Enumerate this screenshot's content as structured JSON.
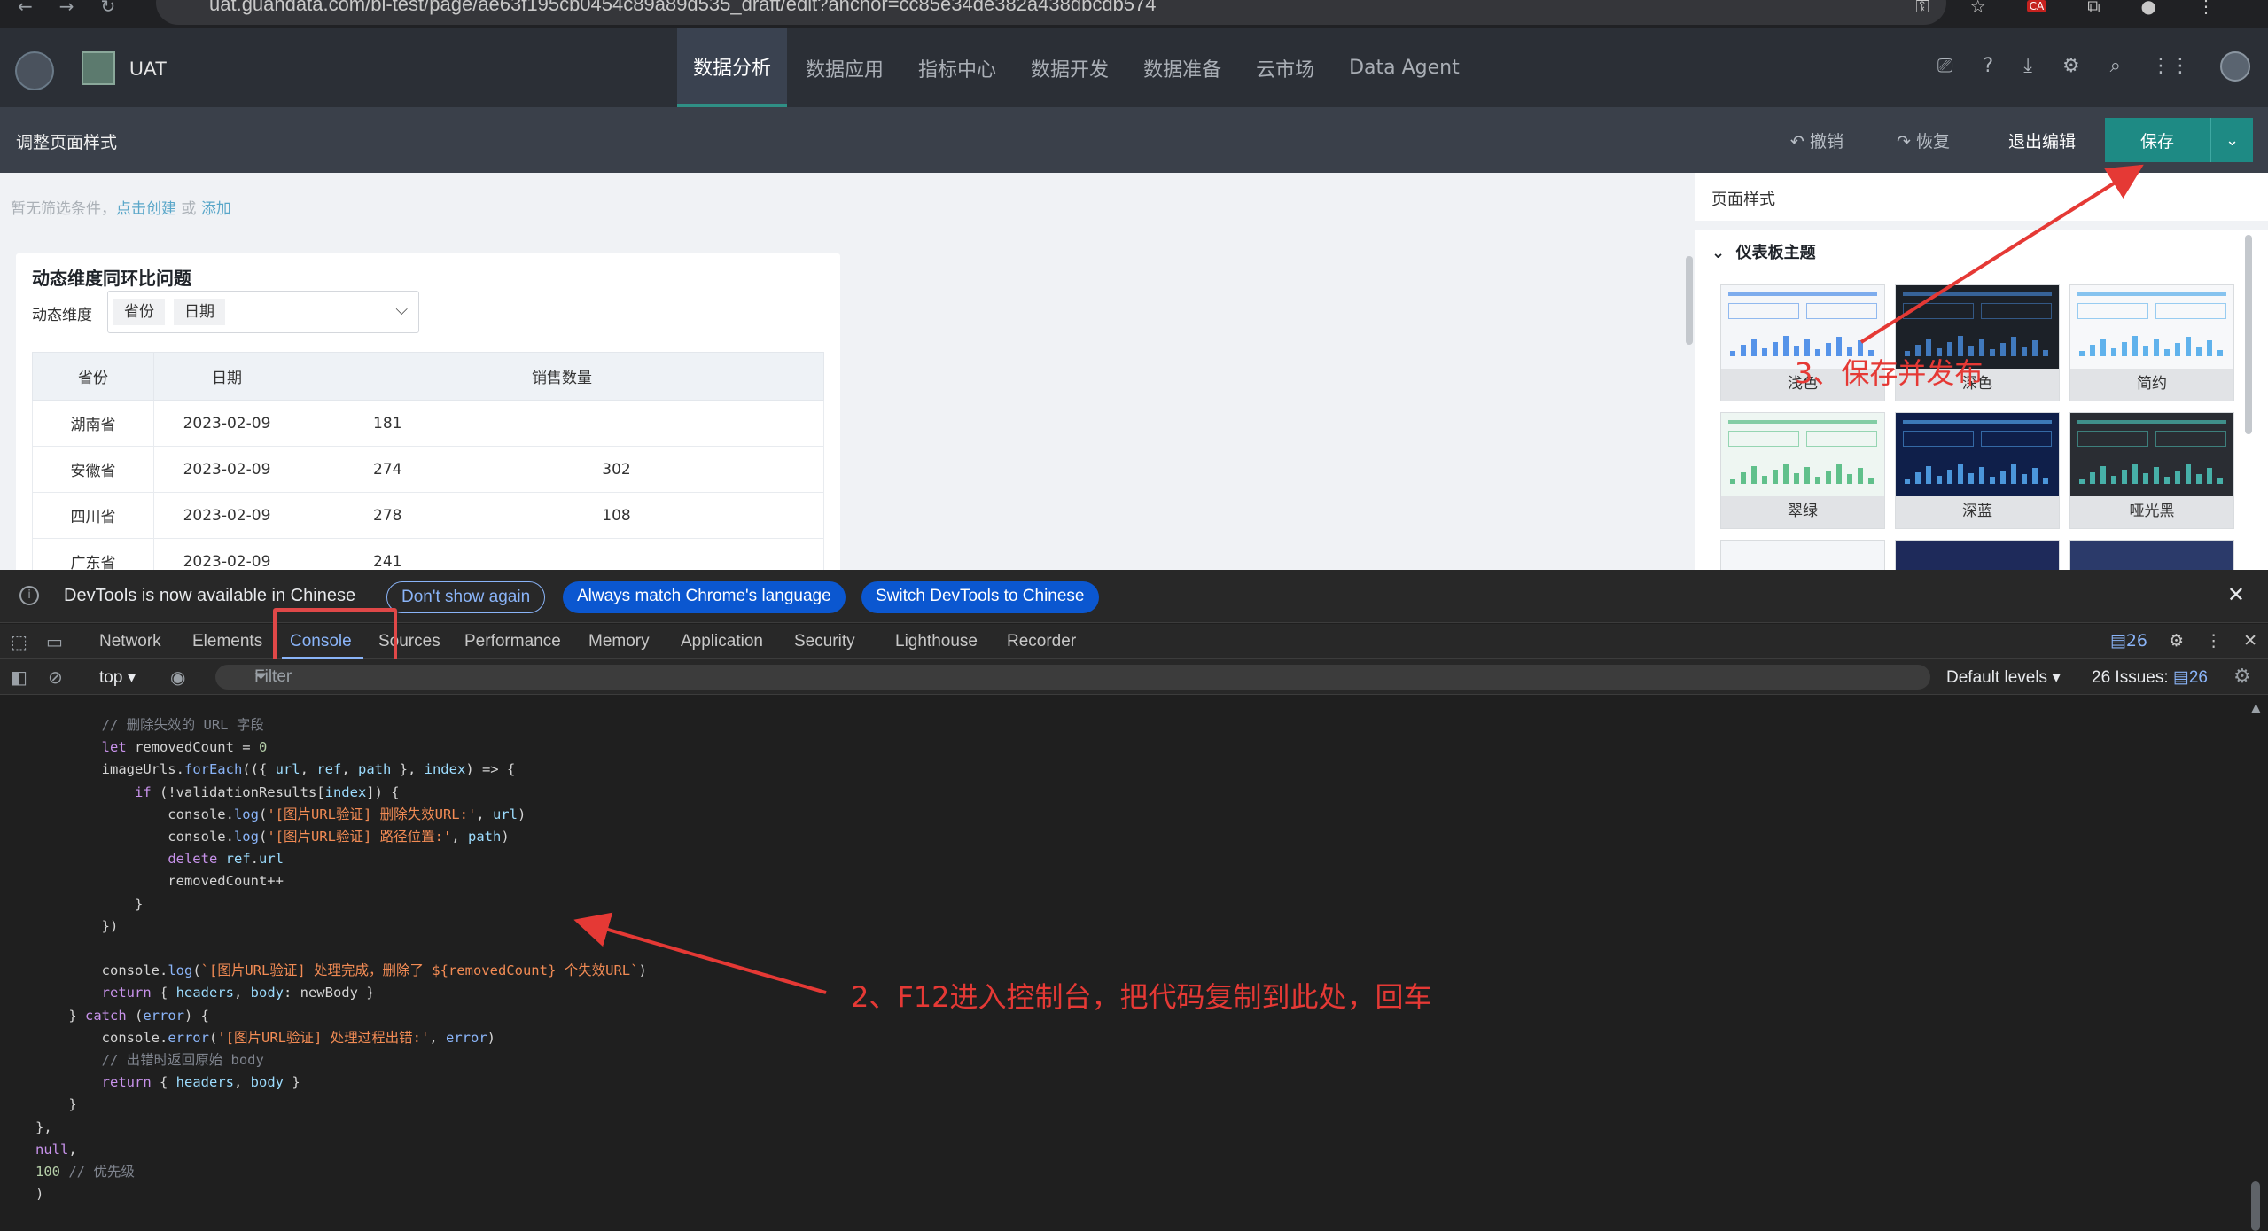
{
  "browser": {
    "url": "uat.guandata.com/bi-test/page/ae63f195cb0454c89a89d535_draft/edit?anchor=cc85e34de382a438dbcdb574",
    "back_icon": "arrow-left-icon",
    "forward_icon": "arrow-right-icon",
    "reload_icon": "reload-icon",
    "extension_badge": "CA"
  },
  "app": {
    "name": "UAT",
    "nav": [
      "数据分析",
      "数据应用",
      "指标中心",
      "数据开发",
      "数据准备",
      "云市场",
      "Data Agent"
    ],
    "active_nav_index": 0,
    "accent_color": "#1e8a84"
  },
  "editor": {
    "title": "调整页面样式",
    "undo": "撤销",
    "redo": "恢复",
    "exit": "退出编辑",
    "save": "保存"
  },
  "canvas": {
    "filter_hint_prefix": "暂无筛选条件，",
    "filter_hint_create": "点击创建",
    "filter_hint_or": " 或 ",
    "filter_hint_add": "添加"
  },
  "widget": {
    "title": "动态维度同环比问题",
    "dimension_label": "动态维度",
    "dimension_tags": [
      "省份",
      "日期"
    ],
    "columns": [
      "省份",
      "日期",
      "销售数量"
    ],
    "rows": [
      {
        "province": "湖南省",
        "date": "2023-02-09",
        "qty": "181",
        "extra": ""
      },
      {
        "province": "安徽省",
        "date": "2023-02-09",
        "qty": "274",
        "extra": "302"
      },
      {
        "province": "四川省",
        "date": "2023-02-09",
        "qty": "278",
        "extra": "108"
      },
      {
        "province": "广东省",
        "date": "2023-02-09",
        "qty": "241",
        "extra": ""
      }
    ]
  },
  "right_panel": {
    "title": "页面样式",
    "section": "仪表板主题",
    "themes": [
      {
        "name": "浅色",
        "bg": "#f4f6f9",
        "accent": "#2d7be5"
      },
      {
        "name": "深色",
        "bg": "#1c2128",
        "accent": "#4a90e2"
      },
      {
        "name": "简约",
        "bg": "#f7f8fa",
        "accent": "#3aa0e8"
      },
      {
        "name": "翠绿",
        "bg": "#eef6f2",
        "accent": "#3cb371"
      },
      {
        "name": "深蓝",
        "bg": "#0f1f4a",
        "accent": "#5ab4ff"
      },
      {
        "name": "哑光黑",
        "bg": "#2a2d33",
        "accent": "#4fd1c5"
      }
    ]
  },
  "devtools": {
    "infobar_text": "DevTools is now available in Chinese",
    "dont_show": "Don't show again",
    "match_lang": "Always match Chrome's language",
    "switch_lang": "Switch DevTools to Chinese",
    "tabs": [
      "Network",
      "Elements",
      "Console",
      "Sources",
      "Performance",
      "Memory",
      "Application",
      "Security",
      "Lighthouse",
      "Recorder"
    ],
    "active_tab": "Console",
    "issues_badge": "26",
    "context": "top",
    "filter_placeholder": "Filter",
    "levels": "Default levels",
    "issues_label": "26 Issues:",
    "issues_count": "26"
  },
  "console_lines": [
    "        // 删除失效的 URL 字段",
    "        let removedCount = 0",
    "        imageUrls.forEach(({ url, ref, path }, index) => {",
    "            if (!validationResults[index]) {",
    "                console.log('[图片URL验证] 删除失效URL:', url)",
    "                console.log('[图片URL验证] 路径位置:', path)",
    "                delete ref.url",
    "                removedCount++",
    "            }",
    "        })",
    "",
    "        console.log(`[图片URL验证] 处理完成，删除了 ${removedCount} 个失效URL`)",
    "        return { headers, body: newBody }",
    "    } catch (error) {",
    "        console.error('[图片URL验证] 处理过程出错:', error)",
    "        // 出错时返回原始 body",
    "        return { headers, body }",
    "    }",
    "},",
    "null,",
    "100 // 优先级",
    ")"
  ],
  "annotations": {
    "step2": "2、F12进入控制台，把代码复制到此处，回车",
    "step3": "3、保存并发布"
  }
}
